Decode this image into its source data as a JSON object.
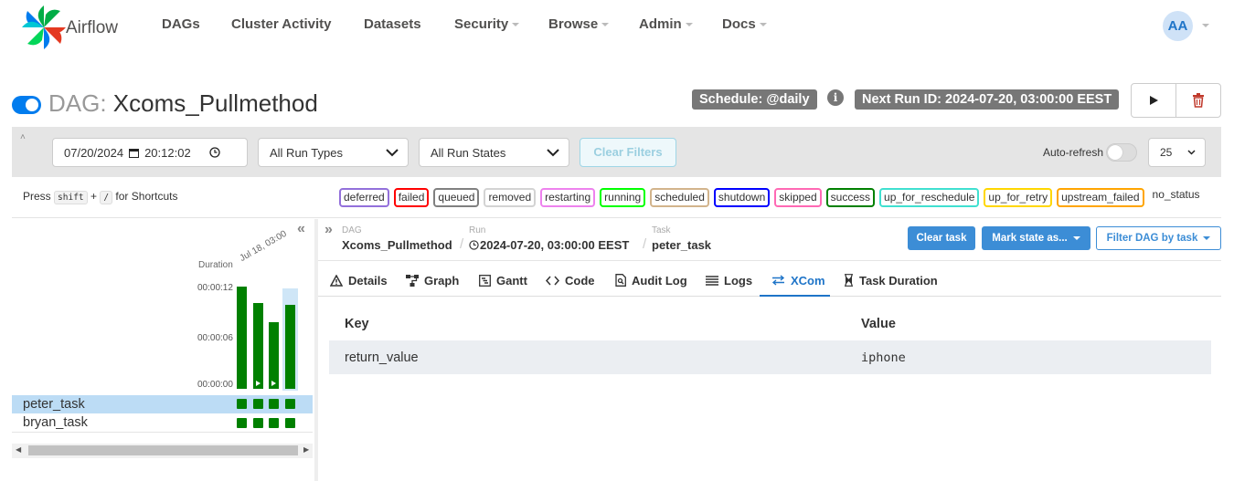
{
  "app": {
    "name": "Airflow"
  },
  "nav": {
    "items": [
      {
        "label": "DAGs",
        "dropdown": false
      },
      {
        "label": "Cluster Activity",
        "dropdown": false
      },
      {
        "label": "Datasets",
        "dropdown": false
      },
      {
        "label": "Security",
        "dropdown": true
      },
      {
        "label": "Browse",
        "dropdown": true
      },
      {
        "label": "Admin",
        "dropdown": true
      },
      {
        "label": "Docs",
        "dropdown": true
      }
    ],
    "user_initials": "AA"
  },
  "dag": {
    "prefix": "DAG: ",
    "name": "Xcoms_Pullmethod",
    "schedule": "Schedule: @daily",
    "next_run": "Next Run ID: 2024-07-20, 03:00:00 EEST",
    "paused": false
  },
  "filters": {
    "date": "07/20/2024",
    "time": "20:12:02",
    "run_types": "All Run Types",
    "run_states": "All Run States",
    "clear_label": "Clear Filters",
    "auto_refresh_label": "Auto-refresh",
    "auto_refresh_on": false,
    "page_size": "25"
  },
  "shortcuts": {
    "prefix": "Press",
    "key1": "shift",
    "plus": "+",
    "key2": "/",
    "suffix": "for Shortcuts"
  },
  "legend": [
    {
      "label": "deferred",
      "color": "#9370db"
    },
    {
      "label": "failed",
      "color": "#ff0000"
    },
    {
      "label": "queued",
      "color": "#808080"
    },
    {
      "label": "removed",
      "color": "#d3d3d3"
    },
    {
      "label": "restarting",
      "color": "#ee82ee"
    },
    {
      "label": "running",
      "color": "#00ff00"
    },
    {
      "label": "scheduled",
      "color": "#d2b48c"
    },
    {
      "label": "shutdown",
      "color": "#0000ff"
    },
    {
      "label": "skipped",
      "color": "#ff69b4"
    },
    {
      "label": "success",
      "color": "#008000"
    },
    {
      "label": "up_for_reschedule",
      "color": "#40e0d0"
    },
    {
      "label": "up_for_retry",
      "color": "#ffd700"
    },
    {
      "label": "upstream_failed",
      "color": "#ffa500"
    },
    {
      "label": "no_status",
      "color": "none"
    }
  ],
  "grid": {
    "duration_label": "Duration",
    "date_label": "Jul 18, 03:00",
    "y_ticks": [
      "00:00:12",
      "00:00:06",
      "00:00:00"
    ],
    "run_durations_sec": [
      12.2,
      10.3,
      8.0,
      10.0
    ],
    "tasks": [
      {
        "name": "peter_task",
        "selected": true
      },
      {
        "name": "bryan_task",
        "selected": false
      }
    ],
    "status_color": "#008000"
  },
  "breadcrumb": {
    "dag_label": "DAG",
    "dag_value": "Xcoms_Pullmethod",
    "run_label": "Run",
    "run_value": "2024-07-20, 03:00:00 EEST",
    "task_label": "Task",
    "task_value": "peter_task"
  },
  "actions": {
    "clear_task": "Clear task",
    "mark_state": "Mark state as...",
    "filter_dag": "Filter DAG by task"
  },
  "tabs": [
    {
      "label": "Details",
      "icon": "warning-triangle-icon"
    },
    {
      "label": "Graph",
      "icon": "graph-icon"
    },
    {
      "label": "Gantt",
      "icon": "gantt-icon"
    },
    {
      "label": "Code",
      "icon": "code-icon"
    },
    {
      "label": "Audit Log",
      "icon": "audit-log-icon"
    },
    {
      "label": "Logs",
      "icon": "logs-icon"
    },
    {
      "label": "XCom",
      "icon": "xcom-arrows-icon",
      "active": true
    },
    {
      "label": "Task Duration",
      "icon": "hourglass-icon"
    }
  ],
  "xcom_table": {
    "headers": [
      "Key",
      "Value"
    ],
    "rows": [
      {
        "key": "return_value",
        "value": "iphone"
      }
    ]
  }
}
